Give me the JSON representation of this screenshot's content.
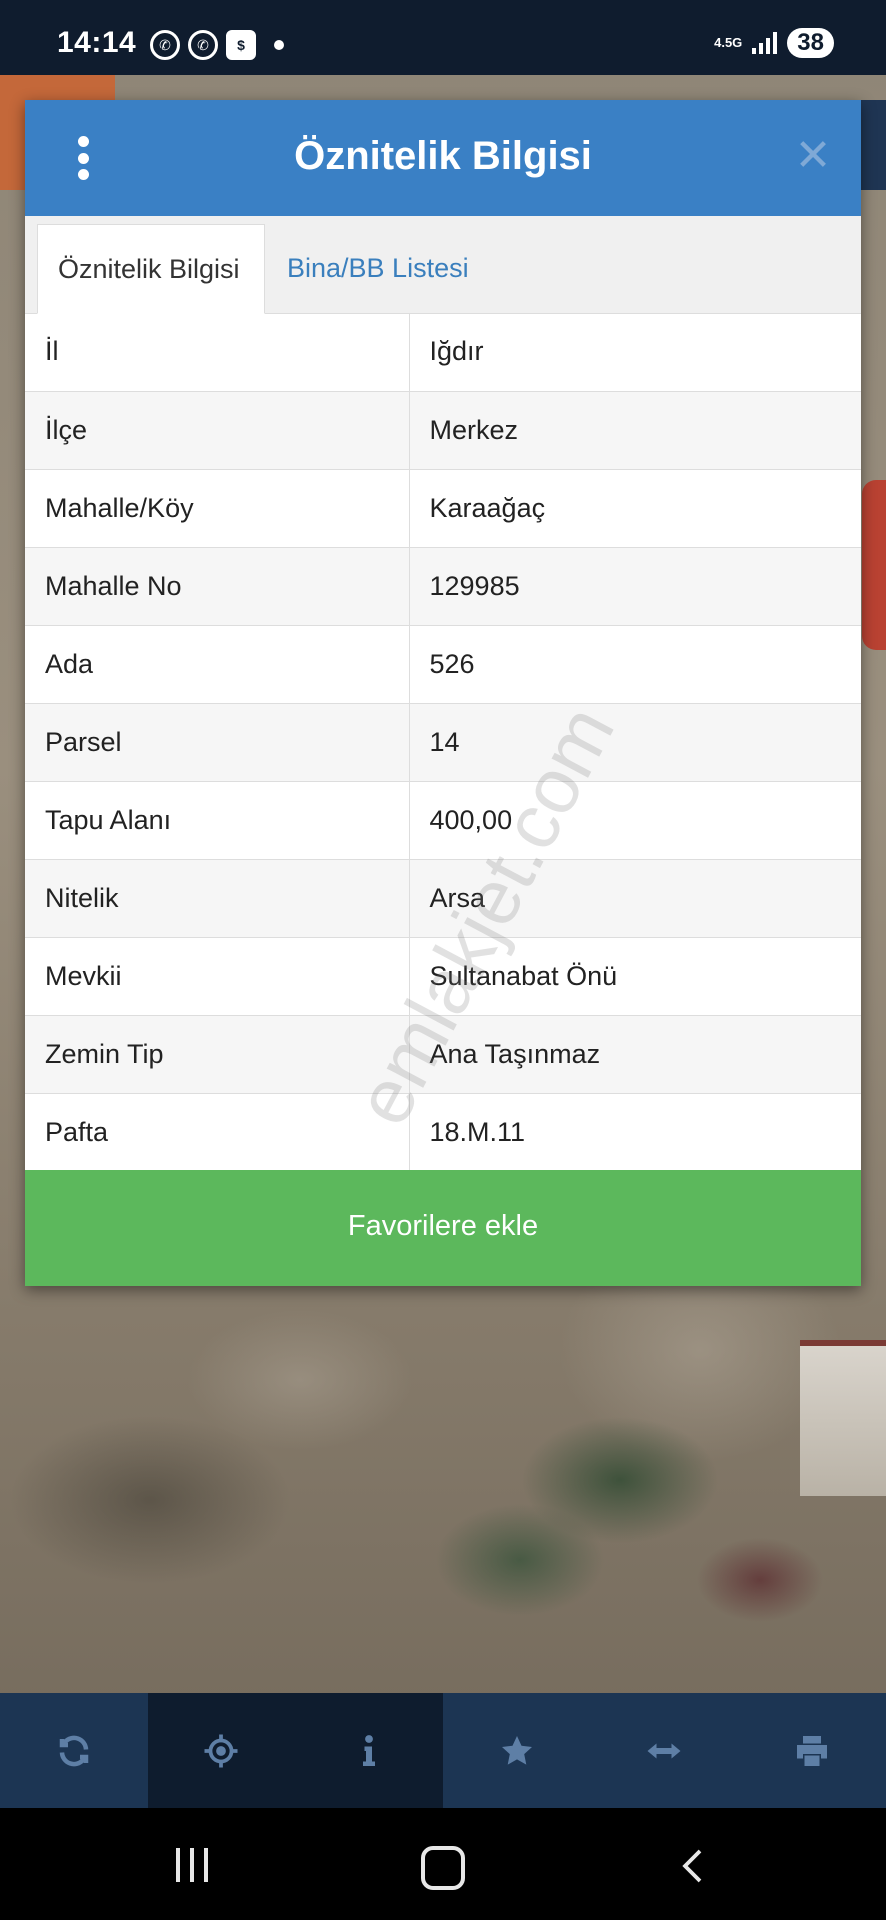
{
  "status_bar": {
    "time": "14:14",
    "network": "4.5G",
    "battery": "38",
    "notification_icons": [
      "whatsapp-icon",
      "whatsapp-business-icon",
      "dollar-app-icon",
      "dot-icon"
    ]
  },
  "dialog": {
    "title": "Öznitelik Bilgisi",
    "tabs": [
      {
        "label": "Öznitelik Bilgisi",
        "active": true
      },
      {
        "label": "Bina/BB Listesi",
        "active": false
      }
    ],
    "rows": [
      {
        "key": "İl",
        "value": "Iğdır"
      },
      {
        "key": "İlçe",
        "value": "Merkez"
      },
      {
        "key": "Mahalle/Köy",
        "value": "Karaağaç"
      },
      {
        "key": "Mahalle No",
        "value": "129985"
      },
      {
        "key": "Ada",
        "value": "526"
      },
      {
        "key": "Parsel",
        "value": "14"
      },
      {
        "key": "Tapu Alanı",
        "value": "400,00"
      },
      {
        "key": "Nitelik",
        "value": "Arsa"
      },
      {
        "key": "Mevkii",
        "value": "Sultanabat Önü"
      },
      {
        "key": "Zemin Tip",
        "value": "Ana Taşınmaz"
      },
      {
        "key": "Pafta",
        "value": "18.M.11"
      }
    ],
    "favorite_button": "Favorilere ekle"
  },
  "watermark": "emlakjet.com",
  "toolbar": {
    "items": [
      "refresh-icon",
      "crosshair-icon",
      "info-icon",
      "star-icon",
      "measure-icon",
      "print-icon"
    ]
  },
  "colors": {
    "header_blue": "#3a80c5",
    "button_green": "#5cb85c",
    "toolbar_bg": "#1c3553",
    "tab_link": "#3a7fbd"
  }
}
